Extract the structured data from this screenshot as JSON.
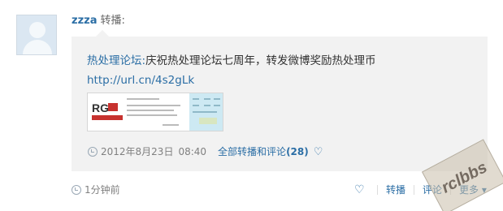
{
  "post": {
    "username": "zzza",
    "action": "转播:",
    "original": {
      "author": "热处理论坛:",
      "text": "庆祝热处理论坛七周年，转发微博奖励热处理币",
      "link": "http://url.cn/4s2gLk"
    },
    "meta": {
      "date": "2012年8月23日",
      "time": "08:40",
      "all_label": "全部转播和评论",
      "count": "(28)"
    },
    "posted": "1分钟前",
    "actions": {
      "repost": "转播",
      "comment": "评论",
      "more": "更多"
    }
  },
  "watermark": "rclbbs",
  "colors": {
    "link": "#2b6ea5",
    "box_bg": "#f2f2f2"
  }
}
